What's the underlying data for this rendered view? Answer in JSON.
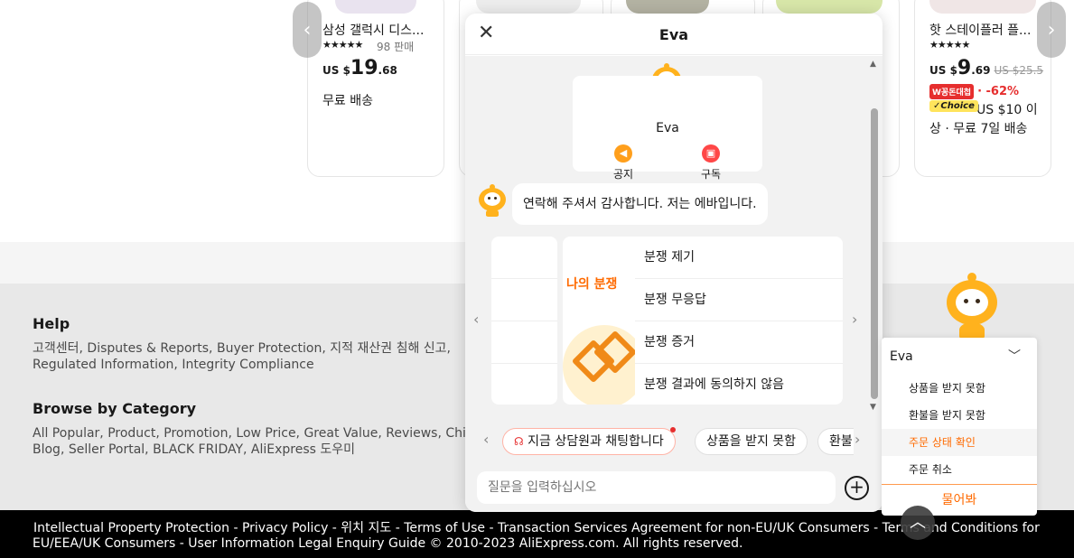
{
  "products": [
    {
      "title": "삼성 갤럭시 디스...",
      "stars": "★★★★★",
      "sold": "98 판매",
      "price_currency": "US $",
      "price_main": "19",
      "price_cents": ".68",
      "shipping": "무료 배송"
    },
    {
      "title": "핫 스테이플러 플...",
      "stars": "★★★★★",
      "price_currency": "US $",
      "price_main": "9",
      "price_cents": ".69",
      "old_price": "US $25.5",
      "deal_badge": "W꽁돈대첩",
      "discount": "· -62%",
      "choice_badge": "✓Choice",
      "choice_text": "US $10 이상 · 무료 7일 배송"
    }
  ],
  "footer": {
    "help_heading": "Help",
    "help_links_1": "고객센터, Disputes & Reports, Buyer Protection, 지적 재산권 침해 신고,",
    "help_links_2": "Regulated Information, Integrity Compliance",
    "browse_heading": "Browse by Category",
    "browse_links_1": "All Popular, Product, Promotion, Low Price, Great Value, Reviews, China Brands,",
    "browse_links_2": "Blog, Seller Portal, BLACK FRIDAY, AliExpress 도우미",
    "legal_line_1": "Intellectual Property Protection  -  Privacy Policy  -  위치 지도  -  Terms of Use  -  Transaction Services Agreement for non-EU/UK Consumers  -  Terms and Conditions for",
    "legal_line_2": "EU/EEA/UK Consumers  -  User Information Legal Enquiry Guide  © 2010-2023 AliExpress.com. All rights reserved."
  },
  "chat": {
    "title": "Eva",
    "profile_name": "Eva",
    "action_notice": "공지",
    "action_subscribe": "구독",
    "greeting": "연락해 주셔서 감사합니다. 저는 에바입니다.",
    "dispute_title": "나의 분쟁",
    "dispute_items": [
      "분쟁 제기",
      "분쟁 무응답",
      "분쟁 증거",
      "분쟁 결과에 동의하지 않음"
    ],
    "chips": [
      "지금 상담원과 채팅합니다",
      "상품을 받지 못함",
      "환불"
    ],
    "input_placeholder": "질문을 입력하십시오"
  },
  "widget": {
    "name": "Eva",
    "items": [
      "상품을 받지 못함",
      "환불을 받지 못함",
      "주문 상태 확인",
      "주문 취소"
    ],
    "active_item": "주문 상태 확인",
    "ask_label": "물어봐"
  },
  "colors": {
    "accent": "#ff6a00",
    "sale_red": "#e62e2e",
    "mascot": "#ffb21d"
  },
  "icons": {
    "close": "close-icon",
    "notice": "megaphone-icon",
    "subscribe": "bag-icon",
    "plus": "plus-icon",
    "back_to_top": "chevron-up-icon"
  }
}
